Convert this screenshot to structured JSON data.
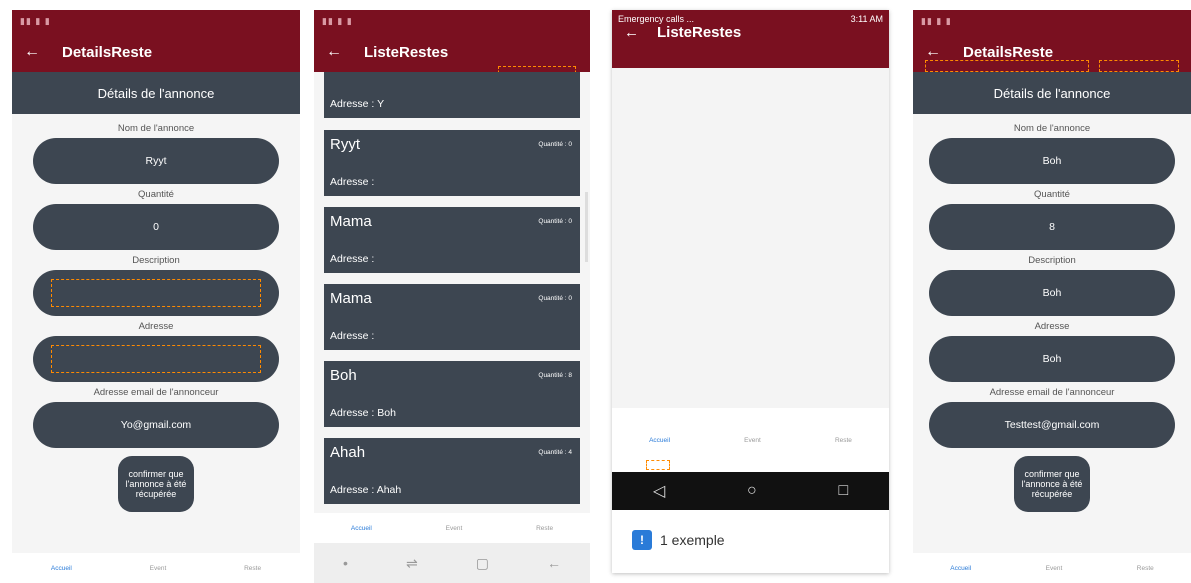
{
  "screen1": {
    "title": "DetailsReste",
    "section": "Détails de l'annonce",
    "fields": [
      {
        "label": "Nom de l'annonce",
        "value": "Ryyt"
      },
      {
        "label": "Quantité",
        "value": "0"
      },
      {
        "label": "Description",
        "value": ""
      },
      {
        "label": "Adresse",
        "value": ""
      },
      {
        "label": "Adresse email de l'annonceur",
        "value": "Yo@gmail.com"
      }
    ],
    "confirm": "confirmer que l'annonce à été récupérée",
    "nav": [
      "Accueil",
      "Event",
      "Reste"
    ]
  },
  "screen2": {
    "title": "ListeRestes",
    "top_address": "Adresse : Y",
    "items": [
      {
        "name": "Ryyt",
        "qty": "Quantité : 0",
        "addr": "Adresse :"
      },
      {
        "name": "Mama",
        "qty": "Quantité : 0",
        "addr": "Adresse :"
      },
      {
        "name": "Mama",
        "qty": "Quantité : 0",
        "addr": "Adresse :"
      },
      {
        "name": "Boh",
        "qty": "Quantité : 8",
        "addr": "Adresse : Boh"
      },
      {
        "name": "Ahah",
        "qty": "Quantité : 4",
        "addr": "Adresse : Ahah"
      }
    ],
    "nav": [
      "Accueil",
      "Event",
      "Reste"
    ]
  },
  "screen3": {
    "status": "Emergency calls ...",
    "time": "3:11 AM",
    "title": "ListeRestes",
    "nav": [
      "Accueil",
      "Event",
      "Reste"
    ],
    "example": "1 exemple"
  },
  "screen4": {
    "title": "DetailsReste",
    "section": "Détails de l'annonce",
    "fields": [
      {
        "label": "Nom de l'annonce",
        "value": "Boh"
      },
      {
        "label": "Quantité",
        "value": "8"
      },
      {
        "label": "Description",
        "value": "Boh"
      },
      {
        "label": "Adresse",
        "value": "Boh"
      },
      {
        "label": "Adresse email de l'annonceur",
        "value": "Testtest@gmail.com"
      }
    ],
    "confirm": "confirmer que l'annonce à été récupérée",
    "nav": [
      "Accueil",
      "Event",
      "Reste"
    ]
  },
  "colors": {
    "primary": "#7a1020",
    "card": "#3d4651",
    "accent": "#2a7bd8",
    "highlight": "#ff8a00"
  }
}
